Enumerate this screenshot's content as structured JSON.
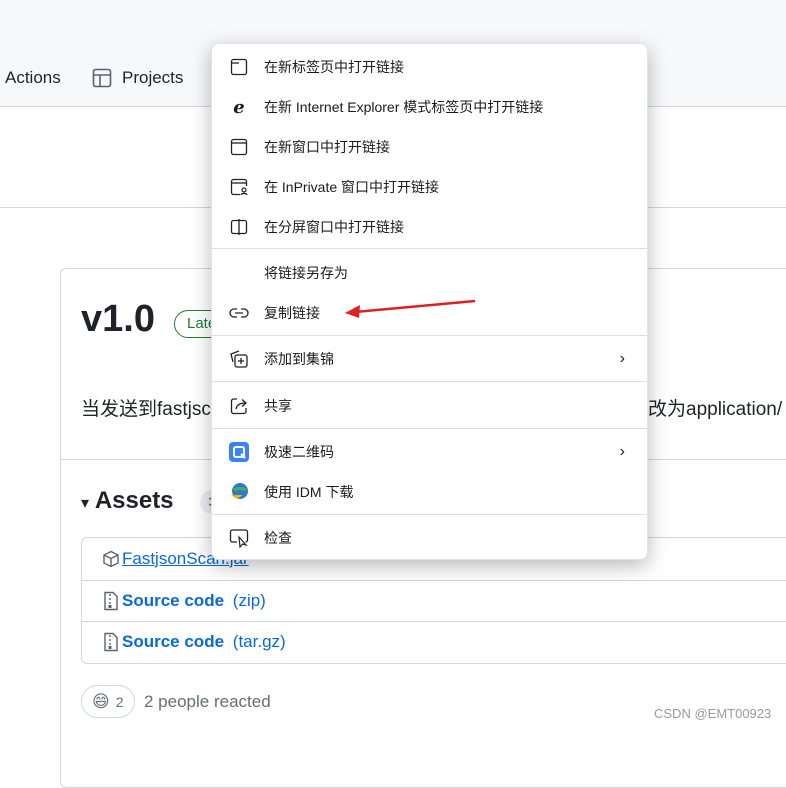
{
  "header": {
    "nav": [
      {
        "label": "Actions"
      },
      {
        "label": "Projects",
        "icon": "table-icon"
      }
    ]
  },
  "release": {
    "version": "v1.0",
    "badge": "Latest",
    "description_left": "当发送到fastjsc",
    "description_right": "改为application/",
    "assets_title": "Assets",
    "assets_count": "3",
    "assets": [
      {
        "name": "FastjsonScan.jar",
        "suffix": "",
        "icon": "package-icon"
      },
      {
        "name": "Source code",
        "suffix": "(zip)",
        "icon": "file-zip-icon"
      },
      {
        "name": "Source code",
        "suffix": "(tar.gz)",
        "icon": "file-zip-icon"
      }
    ],
    "reaction": {
      "emoji": "😄",
      "count": "2",
      "text": "2 people reacted"
    }
  },
  "context_menu": {
    "items": [
      {
        "label": "在新标签页中打开链接",
        "icon": "new-tab-icon"
      },
      {
        "label": "在新 Internet Explorer 模式标签页中打开链接",
        "icon": "ie-icon"
      },
      {
        "label": "在新窗口中打开链接",
        "icon": "window-icon"
      },
      {
        "label": "在 InPrivate 窗口中打开链接",
        "icon": "inprivate-icon"
      },
      {
        "label": "在分屏窗口中打开链接",
        "icon": "split-screen-icon"
      },
      {
        "label": "将链接另存为",
        "icon": ""
      },
      {
        "label": "复制链接",
        "icon": "link-icon"
      },
      {
        "label": "添加到集锦",
        "icon": "collections-icon",
        "submenu": true
      },
      {
        "label": "共享",
        "icon": "share-icon"
      },
      {
        "label": "极速二维码",
        "icon": "qr-extension-icon",
        "submenu": true
      },
      {
        "label": "使用 IDM 下载",
        "icon": "idm-icon"
      },
      {
        "label": "检查",
        "icon": "inspect-icon"
      }
    ]
  },
  "annotation": {
    "arrow_color": "#e02020"
  },
  "watermark": "CSDN @EMT00923"
}
